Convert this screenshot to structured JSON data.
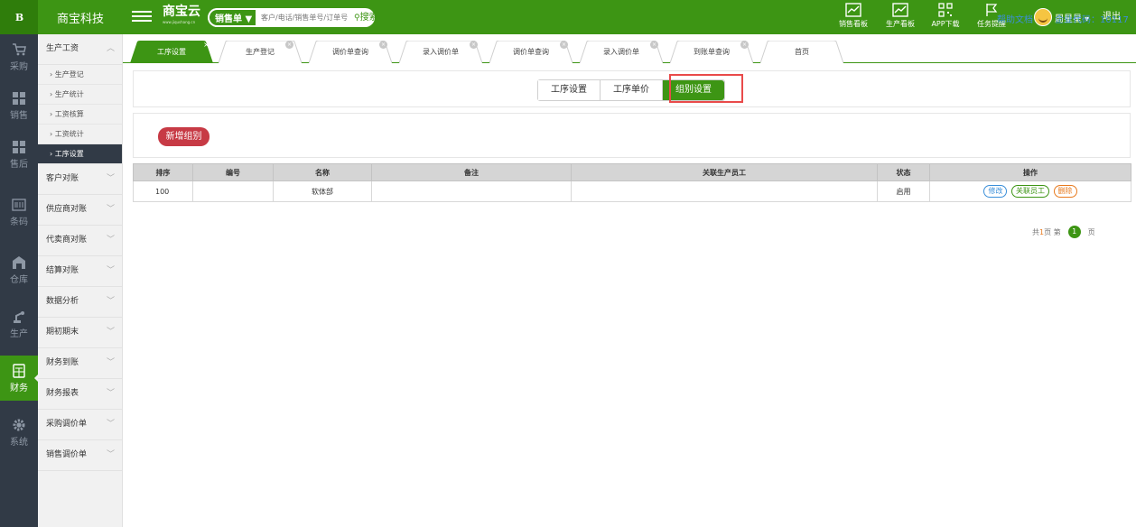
{
  "header": {
    "logo_text": "B",
    "company": "商宝科技",
    "brand": "商宝云",
    "brand_url": "www.jiqushang.cn",
    "search": {
      "type": "销售单 ▼",
      "placeholder": "客户/电话/销售单号/订单号",
      "button": "搜索"
    },
    "tools": [
      {
        "label": "销售看板",
        "icon": "sales-chart-icon"
      },
      {
        "label": "生产看板",
        "icon": "production-chart-icon"
      },
      {
        "label": "APP下载",
        "icon": "qrcode-icon"
      },
      {
        "label": "任务提醒",
        "icon": "flag-icon"
      }
    ],
    "user": "周星星 ▾",
    "logout": "退出"
  },
  "iconbar": [
    {
      "label": "采购",
      "icon": "cart-icon"
    },
    {
      "label": "销售",
      "icon": "grid-icon"
    },
    {
      "label": "售后",
      "icon": "grid-icon"
    },
    {
      "label": "条码",
      "icon": "barcode-icon"
    },
    {
      "label": "仓库",
      "icon": "warehouse-icon"
    },
    {
      "label": "生产",
      "icon": "robot-arm-icon"
    },
    {
      "label": "财务",
      "icon": "calculator-icon"
    },
    {
      "label": "系统",
      "icon": "gear-icon"
    }
  ],
  "submenu": {
    "group1": {
      "label": "生产工资",
      "items": [
        "› 生产登记",
        "› 生产统计",
        "› 工资核算",
        "› 工资统计",
        "› 工序设置"
      ]
    },
    "groups": [
      "客户对账",
      "供应商对账",
      "代卖商对账",
      "结算对账",
      "数据分析",
      "期初期末",
      "财务到账",
      "财务报表",
      "采购调价单",
      "销售调价单"
    ]
  },
  "tabs": [
    "工序设置",
    "生产登记",
    "调价单查询",
    "录入调价单",
    "调价单查询",
    "录入调价单",
    "到账单查询",
    "首页"
  ],
  "help": "帮助文档",
  "company_code": "企业代码：10117",
  "segments": [
    "工序设置",
    "工序单价",
    "组别设置"
  ],
  "add_button": "新增组别",
  "table": {
    "headers": [
      "排序",
      "编号",
      "名称",
      "备注",
      "关联生产员工",
      "状态",
      "操作"
    ],
    "rows": [
      {
        "sort": "100",
        "code": "",
        "name": "软体部",
        "remark": "",
        "staff": "",
        "status": "启用"
      }
    ],
    "ops": [
      "修改",
      "关联员工",
      "删除"
    ]
  },
  "pager": {
    "prefix": "共",
    "total": "1",
    "mid": "页 第",
    "current": "1",
    "suffix": "页"
  },
  "colors": {
    "green": "#3d9514",
    "dark": "#313a46",
    "red": "#c73a45",
    "highlight": "#e94a4a"
  }
}
